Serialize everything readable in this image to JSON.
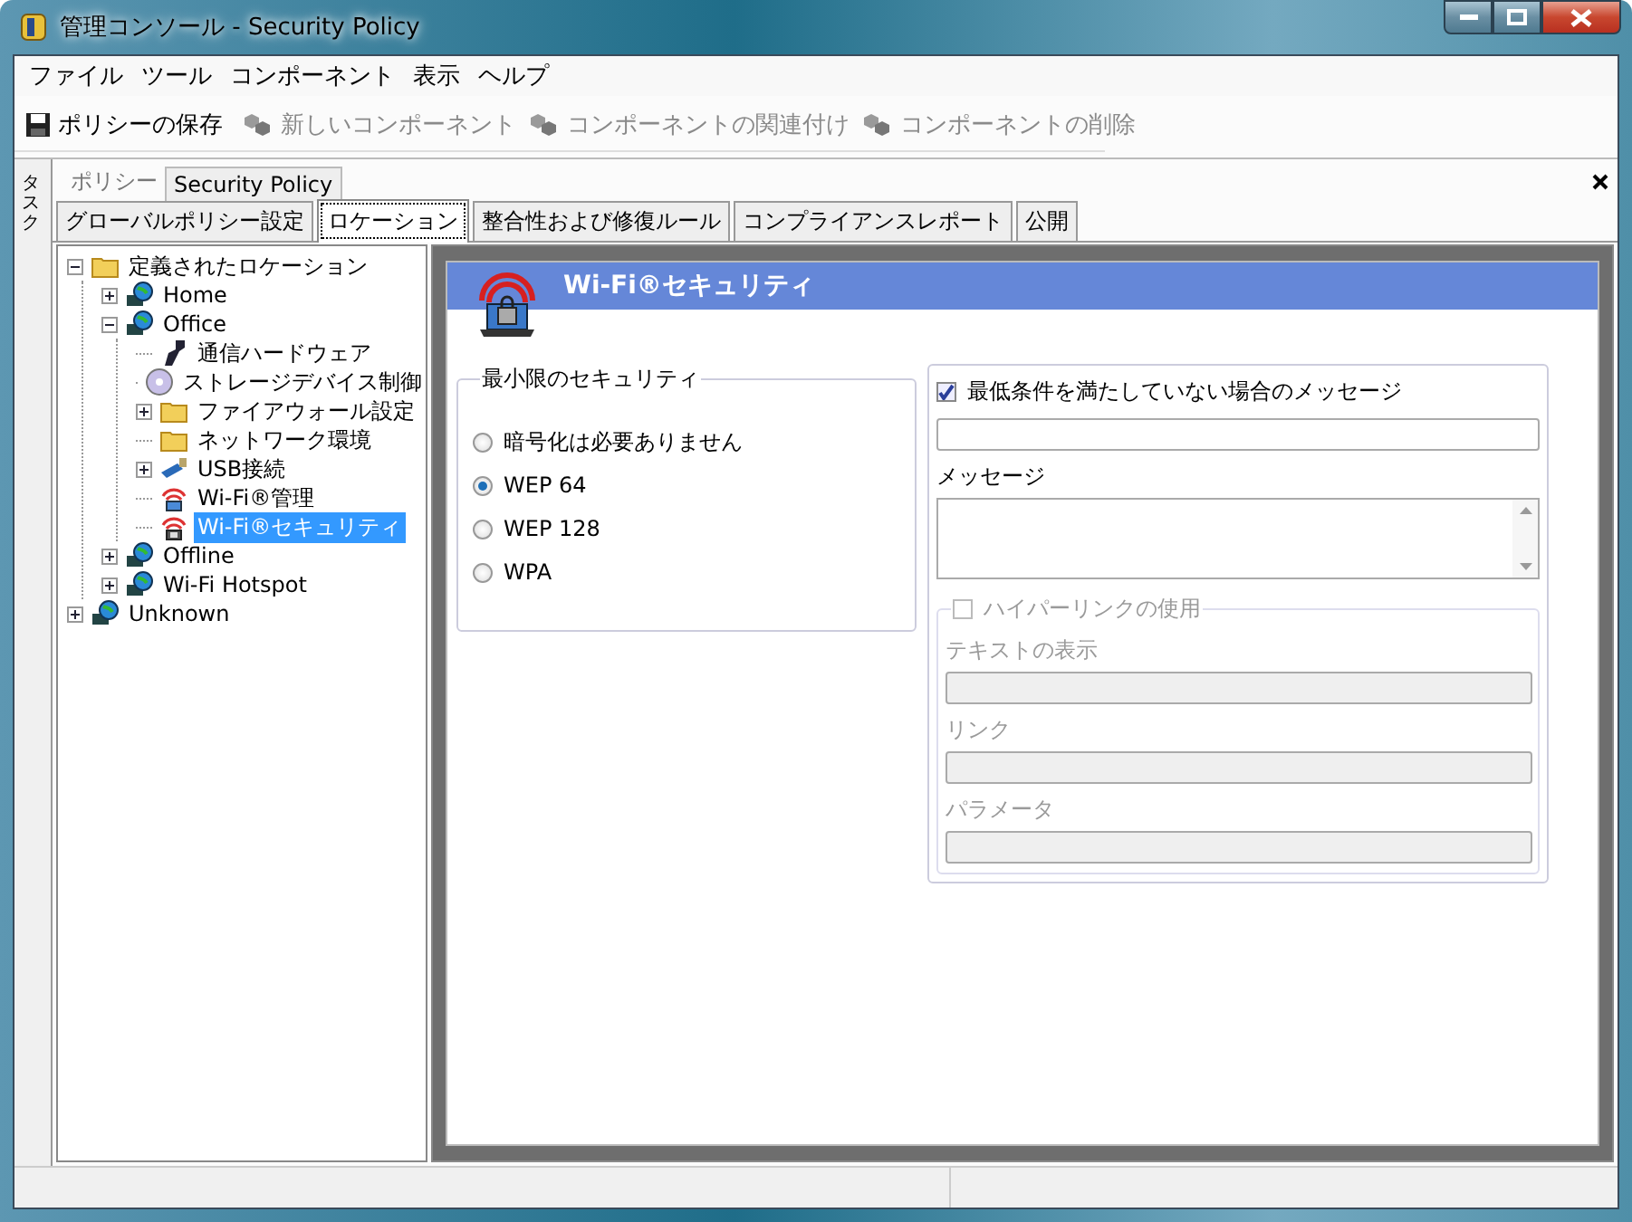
{
  "window": {
    "title": "管理コンソール - Security Policy"
  },
  "menu": [
    "ファイル",
    "ツール",
    "コンポーネント",
    "表示",
    "ヘルプ"
  ],
  "toolbar": [
    {
      "label": "ポリシーの保存",
      "kind": "save",
      "disabled": false
    },
    {
      "label": "新しいコンポーネント",
      "kind": "component",
      "disabled": true
    },
    {
      "label": "コンポーネントの関連付け",
      "kind": "component",
      "disabled": true
    },
    {
      "label": "コンポーネントの削除",
      "kind": "component",
      "disabled": true
    }
  ],
  "side_tab": {
    "label": "タスク"
  },
  "policy": {
    "label": "ポリシー",
    "name": "Security Policy"
  },
  "tabs": [
    {
      "label": "グローバルポリシー設定",
      "selected": false
    },
    {
      "label": "ロケーション",
      "selected": true
    },
    {
      "label": "整合性および修復ルール",
      "selected": false
    },
    {
      "label": "コンプライアンスレポート",
      "selected": false
    },
    {
      "label": "公開",
      "selected": false
    }
  ],
  "tree": [
    {
      "label": "定義されたロケーション",
      "kind": "folder",
      "expanded": true,
      "selected": false,
      "children": [
        {
          "label": "Home",
          "kind": "globe",
          "expanded": false,
          "selected": false
        },
        {
          "label": "Office",
          "kind": "globe",
          "expanded": true,
          "selected": false,
          "children": [
            {
              "label": "通信ハードウェア",
              "kind": "device",
              "selected": false
            },
            {
              "label": "ストレージデバイス制御",
              "kind": "disc",
              "selected": false
            },
            {
              "label": "ファイアウォール設定",
              "kind": "folder",
              "expanded": false,
              "selected": false
            },
            {
              "label": "ネットワーク環境",
              "kind": "folder",
              "selected": false
            },
            {
              "label": "USB接続",
              "kind": "usb",
              "expanded": false,
              "selected": false
            },
            {
              "label": "Wi-Fi®管理",
              "kind": "wifi",
              "selected": false
            },
            {
              "label": "Wi-Fi®セキュリティ",
              "kind": "wifi-lock",
              "selected": true
            }
          ]
        },
        {
          "label": "Offline",
          "kind": "globe",
          "expanded": false,
          "selected": false
        },
        {
          "label": "Wi-Fi Hotspot",
          "kind": "globe",
          "expanded": false,
          "selected": false
        }
      ]
    },
    {
      "label": "Unknown",
      "kind": "globe",
      "expanded": false,
      "selected": false
    }
  ],
  "panel": {
    "title": "Wi-Fi®セキュリティ",
    "security": {
      "legend": "最小限のセキュリティ",
      "options": [
        {
          "label": "暗号化は必要ありません",
          "selected": false
        },
        {
          "label": "WEP 64",
          "selected": true
        },
        {
          "label": "WEP 128",
          "selected": false
        },
        {
          "label": "WPA",
          "selected": false
        }
      ]
    },
    "message": {
      "checkbox": {
        "label": "最低条件を満たしていない場合のメッセージ",
        "checked": true
      },
      "message_label": "メッセージ",
      "hyperlink": {
        "label": "ハイパーリンクの使用",
        "checked": false,
        "disabled": true,
        "fields": [
          {
            "label": "テキストの表示"
          },
          {
            "label": "リンク"
          },
          {
            "label": "パラメータ"
          }
        ]
      }
    }
  }
}
